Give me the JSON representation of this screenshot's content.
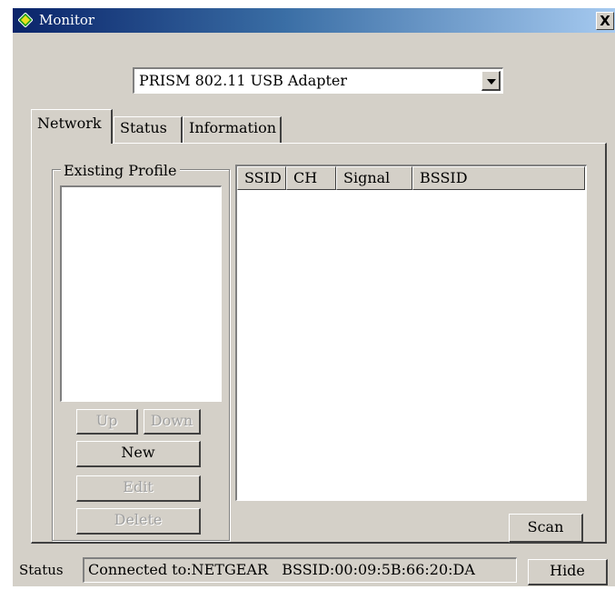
{
  "window": {
    "title": "Monitor",
    "close_label": "X"
  },
  "adapter": {
    "selected": "PRISM 802.11 USB Adapter"
  },
  "tabs": [
    {
      "label": "Network"
    },
    {
      "label": "Status"
    },
    {
      "label": "Information"
    }
  ],
  "profiles": {
    "group_label": "Existing Profile",
    "up_label": "Up",
    "down_label": "Down",
    "new_label": "New",
    "edit_label": "Edit",
    "delete_label": "Delete"
  },
  "network_list": {
    "columns": [
      "SSID",
      "CH",
      "Signal",
      "BSSID"
    ],
    "rows": []
  },
  "scan_label": "Scan",
  "statusbar": {
    "label": "Status",
    "text": "Connected to:NETGEAR   BSSID:00:09:5B:66:20:DA",
    "hide_label": "Hide"
  },
  "colors": {
    "title_start": "#0a246a",
    "title_end": "#a6caf0",
    "face": "#d4d0c8"
  }
}
